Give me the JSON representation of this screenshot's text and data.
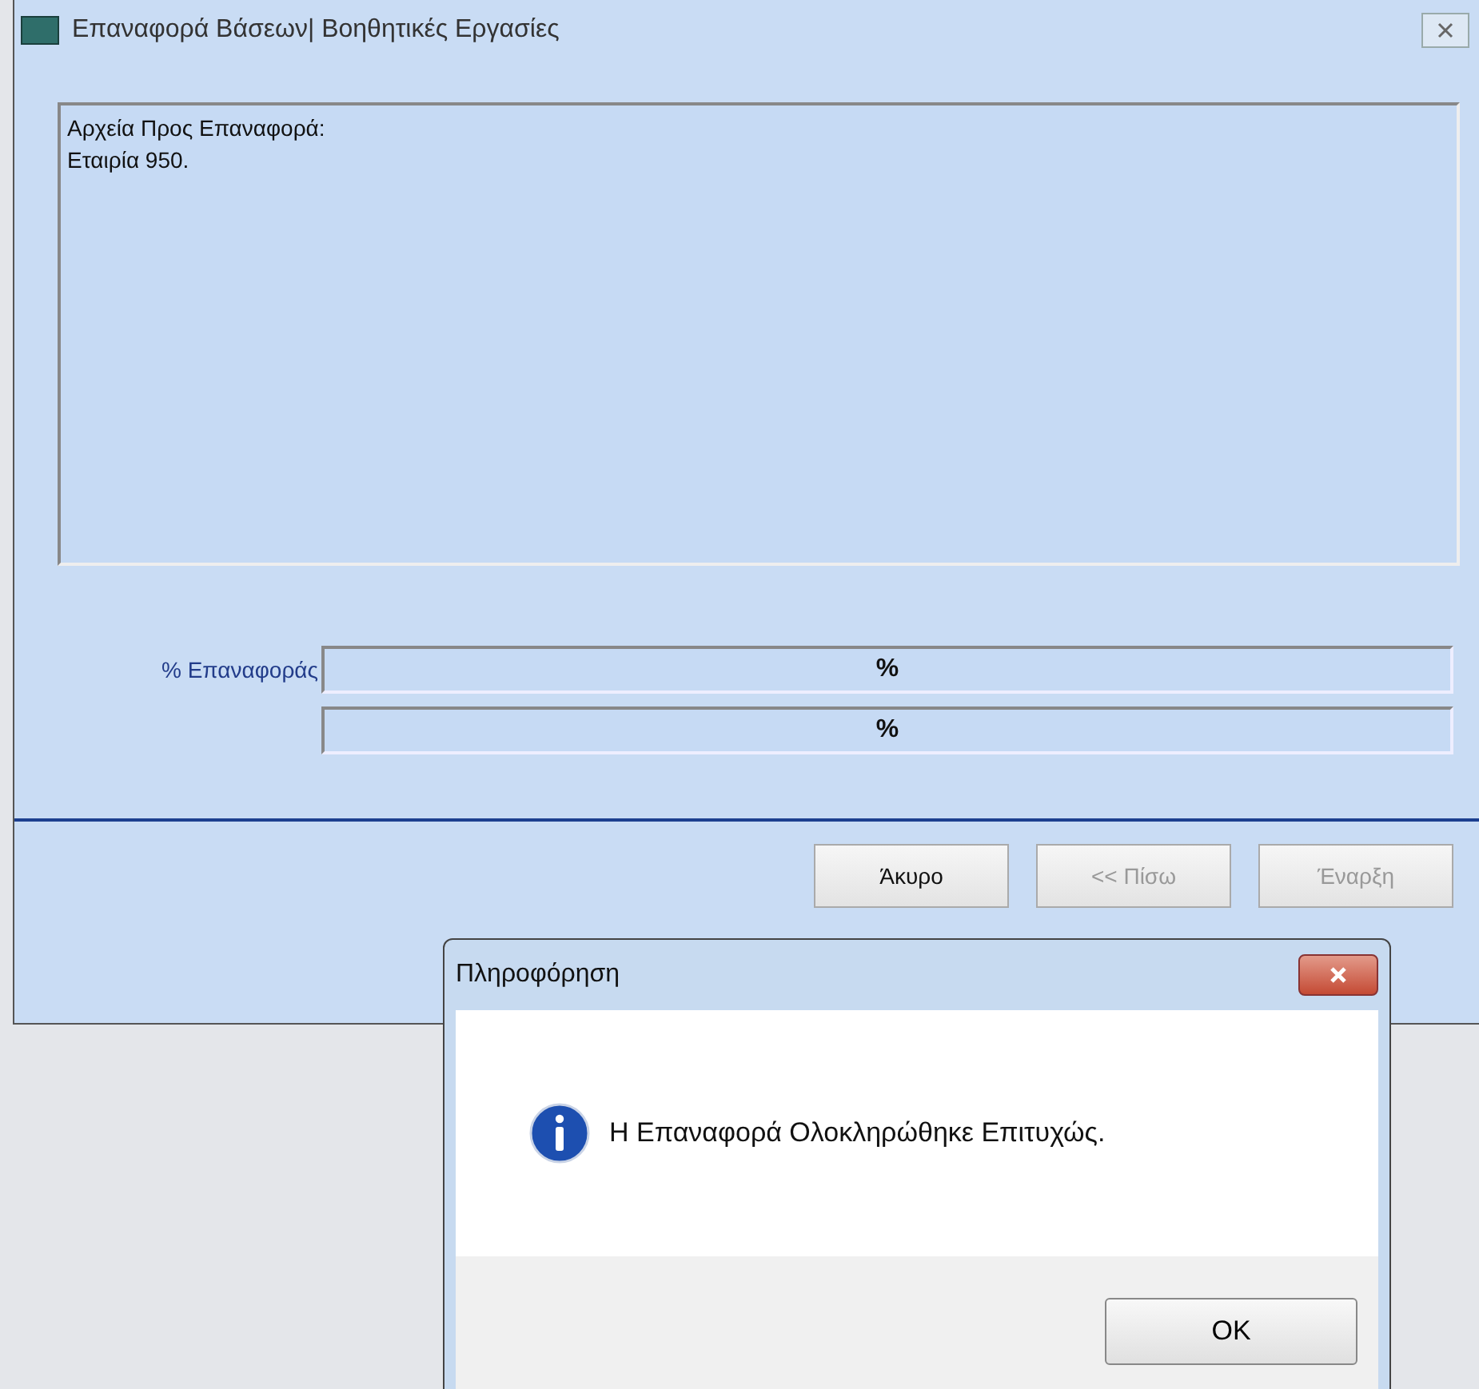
{
  "window": {
    "title": "Επαναφορά Βάσεων| Βοηθητικές Εργασίες"
  },
  "files_box": {
    "lines": [
      "Αρχεία Προς Επαναφορά:",
      "Εταιρία 950."
    ]
  },
  "progress": {
    "label": "% Επαναφοράς",
    "bars": [
      {
        "text": "%",
        "level": 0
      },
      {
        "text": "%",
        "level": 0
      }
    ]
  },
  "buttons": [
    {
      "label": "Άκυρο",
      "disabled": false
    },
    {
      "label": "<< Πίσω",
      "disabled": true
    },
    {
      "label": "Έναρξη",
      "disabled": true
    }
  ],
  "dialog": {
    "title": "Πληροφόρηση",
    "message": "Η Επαναφορά Ολοκληρώθηκε Επιτυχώς.",
    "button": "OK"
  }
}
